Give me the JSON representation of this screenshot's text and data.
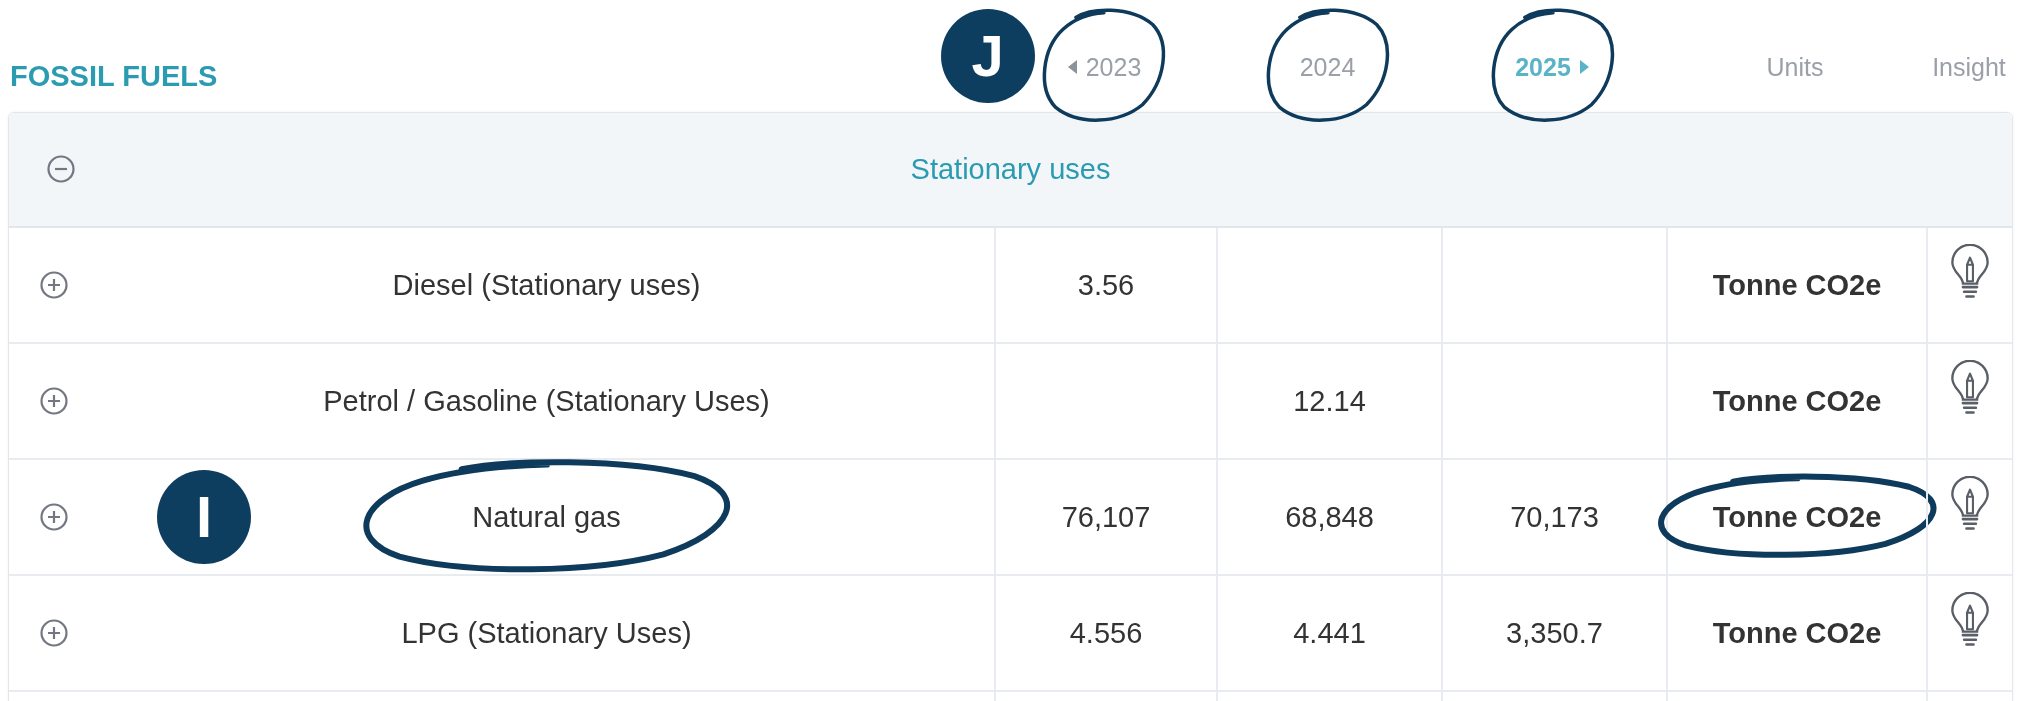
{
  "section_title": "FOSSIL FUELS",
  "years": [
    {
      "label": "2023",
      "selected": false,
      "prev_arrow": true,
      "circled": true,
      "badge": "J"
    },
    {
      "label": "2024",
      "selected": false,
      "circled": true
    },
    {
      "label": "2025",
      "selected": true,
      "next_arrow": true,
      "circled": true
    }
  ],
  "other_headers": [
    "Units",
    "Insight"
  ],
  "group": {
    "title": "Stationary uses",
    "expanded": true
  },
  "rows": [
    {
      "name": "Diesel (Stationary uses)",
      "expanded": false,
      "values": [
        {
          "kind": "value",
          "text": "3.56"
        },
        {
          "kind": "empty"
        },
        {
          "kind": "empty"
        }
      ],
      "unit": "Tonne CO2e"
    },
    {
      "name": "Petrol / Gasoline (Stationary Uses)",
      "expanded": false,
      "values": [
        {
          "kind": "empty"
        },
        {
          "kind": "value",
          "text": "12.14"
        },
        {
          "kind": "empty"
        }
      ],
      "unit": "Tonne CO2e"
    },
    {
      "name": "Natural gas",
      "expanded": false,
      "values": [
        {
          "kind": "value",
          "text": "76,107"
        },
        {
          "kind": "value",
          "text": "68,848"
        },
        {
          "kind": "value",
          "text": "70,173"
        }
      ],
      "unit": "Tonne CO2e",
      "badge": "I",
      "name_circled": true,
      "unit_circled": true
    },
    {
      "name": "LPG (Stationary Uses)",
      "expanded": false,
      "values": [
        {
          "kind": "value",
          "text": "4.556"
        },
        {
          "kind": "value",
          "text": "4.441"
        },
        {
          "kind": "value",
          "text": "3,350.7"
        }
      ],
      "unit": "Tonne CO2e"
    }
  ]
}
